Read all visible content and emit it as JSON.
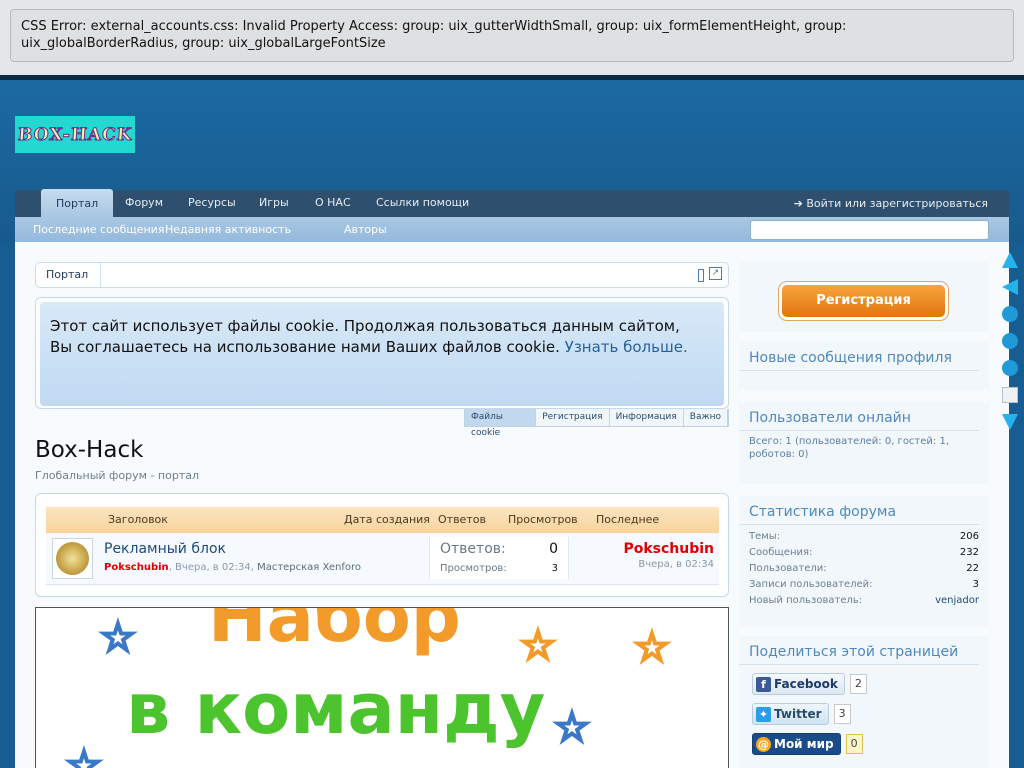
{
  "error": {
    "text": "CSS Error: external_accounts.css: Invalid Property Access: group: uix_gutterWidthSmall, group: uix_formElementHeight, group: uix_globalBorderRadius, group: uix_globalLargeFontSize"
  },
  "logo": {
    "text": "BOX-HACK"
  },
  "nav": {
    "tabs": [
      {
        "label": "Портал"
      },
      {
        "label": "Форум"
      },
      {
        "label": "Ресурсы"
      },
      {
        "label": "Игры"
      },
      {
        "label": "О НАС"
      },
      {
        "label": "Ссылки помощи"
      }
    ],
    "login": "Войти или зарегистрироваться",
    "sub": [
      "Последние сообщения",
      "Недавняя активность",
      "Авторы"
    ]
  },
  "breadcrumb": {
    "home": "Портал"
  },
  "cookie": {
    "line1": "Этот сайт использует файлы cookie. Продолжая пользоваться данным сайтом,",
    "line2": "Вы соглашаетесь на использование нами Ваших файлов cookie.",
    "more": "Узнать больше.",
    "tabs": [
      "Файлы cookie",
      "Регистрация",
      "Информация",
      "Важно"
    ]
  },
  "page": {
    "title": "Box-Hack",
    "description": "Глобальный форум - портал"
  },
  "threads": {
    "headers": {
      "title": "Заголовок",
      "created": "Дата создания",
      "replies": "Ответов",
      "views": "Просмотров",
      "last": "Последнее сообщение"
    },
    "rows": [
      {
        "title": "Рекламный блок",
        "author": "Pokschubin",
        "date": "Вчера, в 02:34",
        "forum": "Мастерская Xenforo",
        "replies_label": "Ответов:",
        "replies": "0",
        "views_label": "Просмотров:",
        "views": "3",
        "last_user": "Pokschubin",
        "last_time": "Вчера, в 02:34"
      }
    ]
  },
  "banner": {
    "line1": "Набор",
    "line2": "в команду"
  },
  "sidebar": {
    "register": "Регистрация",
    "new_profile_posts": "Новые сообщения профиля",
    "online": {
      "title": "Пользователи онлайн",
      "text": "Всего: 1 (пользователей: 0, гостей: 1, роботов: 0)"
    },
    "stats": {
      "title": "Статистика форума",
      "rows": [
        {
          "label": "Темы:",
          "value": "206"
        },
        {
          "label": "Сообщения:",
          "value": "232"
        },
        {
          "label": "Пользователи:",
          "value": "22"
        },
        {
          "label": "Записи пользователей:",
          "value": "3"
        },
        {
          "label": "Новый пользователь:",
          "value": "venjador"
        }
      ]
    },
    "share": {
      "title": "Поделиться этой страницей",
      "items": [
        {
          "label": "Facebook",
          "count": "2"
        },
        {
          "label": "Twitter",
          "count": "3"
        },
        {
          "label": "Мой мир",
          "count": "0"
        }
      ]
    }
  },
  "colors": {
    "header": "#185d91",
    "nav": "#2f4f6e",
    "subnav": "#a8c7e4",
    "accent_orange": "#f39b2a",
    "user_red": "#e00000"
  }
}
